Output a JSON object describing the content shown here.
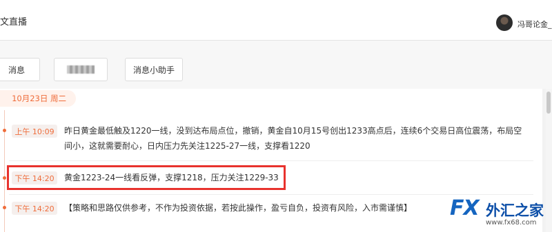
{
  "header": {
    "title": "文直播",
    "username": "冯哥论金_"
  },
  "tabs": [
    "消息",
    "",
    "消息小助手"
  ],
  "feed": {
    "date": "10月23日 周二",
    "entries": [
      {
        "time": "上午 10:09",
        "text": "昨日黄金最低触及1220一线，没到达布局点位，撤销，黄金自10月15号创出1233高点后，连续6个交易日高位震荡，布局空间小，这就需要耐心，日内压力先关注1225-27一线，支撑看1220"
      },
      {
        "time": "下午 14:20",
        "text": "黄金1223-24一线看反弹，支撑1218，压力关注1229-33"
      },
      {
        "time": "下午 14:20",
        "text": "【策略和思路仅供参考，不作为投资依据，若按此操作，盈亏自负，投资有风险，入市需谨慎】"
      }
    ]
  },
  "watermark": {
    "logo": "FX",
    "name": "外汇之家",
    "url": "www.fx68.com"
  },
  "colors": {
    "accent": "#ef6c3a",
    "highlight": "#e8322d",
    "brand": "#1565c0"
  }
}
